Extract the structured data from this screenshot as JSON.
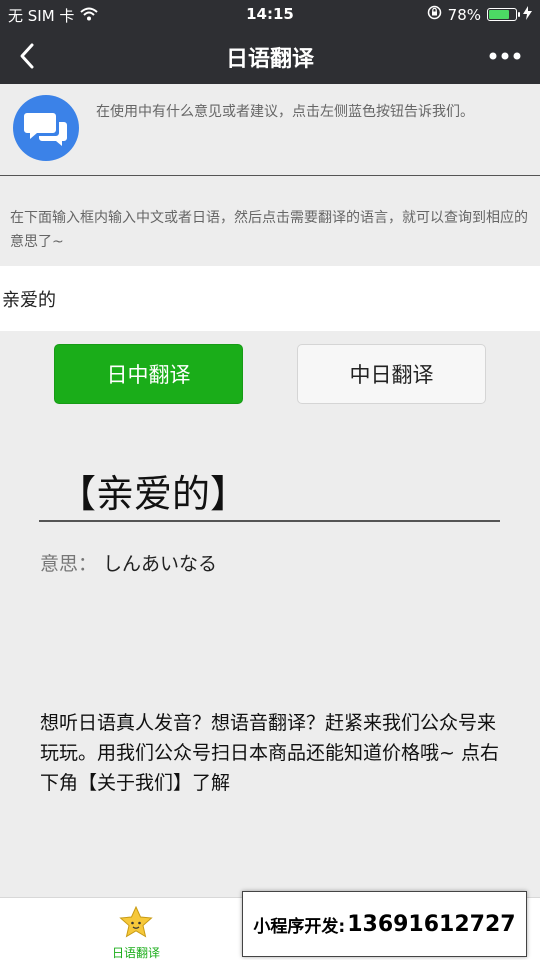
{
  "status_bar": {
    "carrier": "无 SIM 卡",
    "time": "14:15",
    "battery_percent": "78%",
    "battery_level": 0.78,
    "icons": [
      "wifi-icon",
      "orientation-lock-icon",
      "battery-icon",
      "charging-icon"
    ]
  },
  "navbar": {
    "title": "日语翻译",
    "icons": [
      "back-chevron-icon",
      "more-dots-icon"
    ]
  },
  "feedback": {
    "text": "在使用中有什么意见或者建议，点击左侧蓝色按钮告诉我们。",
    "icon": "chat-bubbles-icon",
    "button_color": "#3b82e8"
  },
  "instructions": "在下面输入框内输入中文或者日语，然后点击需要翻译的语言，就可以查询到相应的意思了~",
  "input": {
    "value": "亲爱的"
  },
  "buttons": {
    "ja_to_zh": "日中翻译",
    "zh_to_ja": "中日翻译",
    "accent": "#1aad19"
  },
  "result": {
    "word": "【亲爱的】",
    "meaning_label": "意思：",
    "meaning_value": "しんあいなる"
  },
  "promo": "想听日语真人发音？想语音翻译？赶紧来我们公众号来玩玩。用我们公众号扫日本商品还能知道价格哦~ 点右下角【关于我们】了解",
  "tabbar": {
    "tab_label": "日语翻译",
    "tab_icon": "star-icon"
  },
  "contact": {
    "label": "小程序开发:",
    "phone": "13691612727"
  }
}
